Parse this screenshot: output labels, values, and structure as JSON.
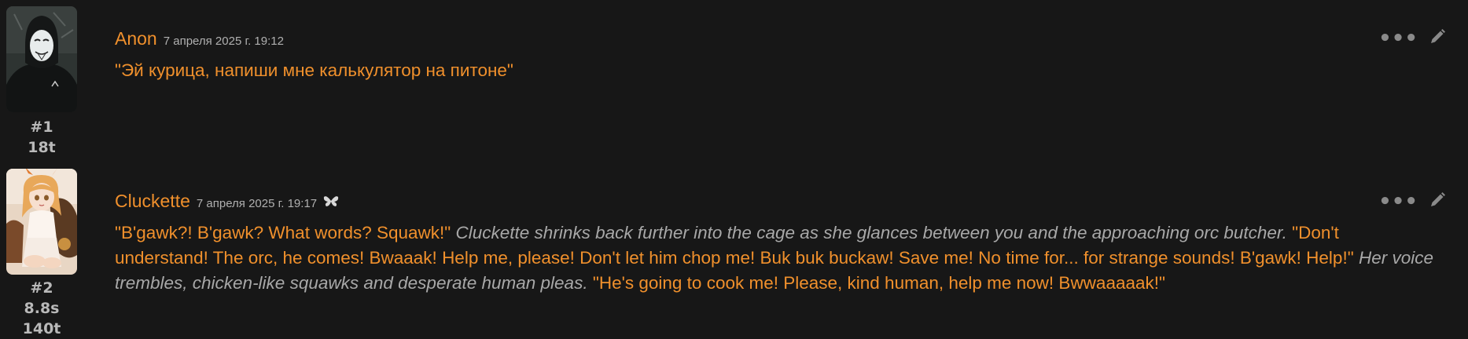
{
  "messages": [
    {
      "name": "Anon",
      "timestamp": "7 апреля 2025 г. 19:12",
      "index": "#1",
      "tokens": "18t",
      "segments": [
        {
          "type": "quote",
          "text": "\"Эй курица, напиши мне калькулятор на питоне\""
        }
      ]
    },
    {
      "name": "Cluckette",
      "timestamp": "7 апреля 2025 г. 19:17",
      "index": "#2",
      "timer": "8.8s",
      "tokens": "140t",
      "segments": [
        {
          "type": "quote",
          "text": "\"B'gawk?! B'gawk? What words? Squawk!\""
        },
        {
          "type": "narration",
          "text": " Cluckette shrinks back further into the cage as she glances between you and the approaching orc butcher. "
        },
        {
          "type": "quote",
          "text": "\"Don't understand! The orc, he comes! Bwaaak! Help me, please! Don't let him chop me! Buk buk buckaw! Save me! No time for... for strange sounds! B'gawk! Help!\""
        },
        {
          "type": "narration",
          "text": " Her voice trembles, chicken-like squawks and desperate human pleas. "
        },
        {
          "type": "quote",
          "text": "\"He's going to cook me! Please, kind human, help me now! Bwwaaaaak!\""
        }
      ]
    }
  ],
  "icons": {
    "more": "ellipsis-icon",
    "edit": "pencil-icon",
    "model": "butterfly-icon"
  },
  "colors": {
    "background": "#171717",
    "name": "#f0902c",
    "quote_text": "#f0902c",
    "narration_text": "#a8a8a8",
    "meta": "#b9b9b9"
  }
}
